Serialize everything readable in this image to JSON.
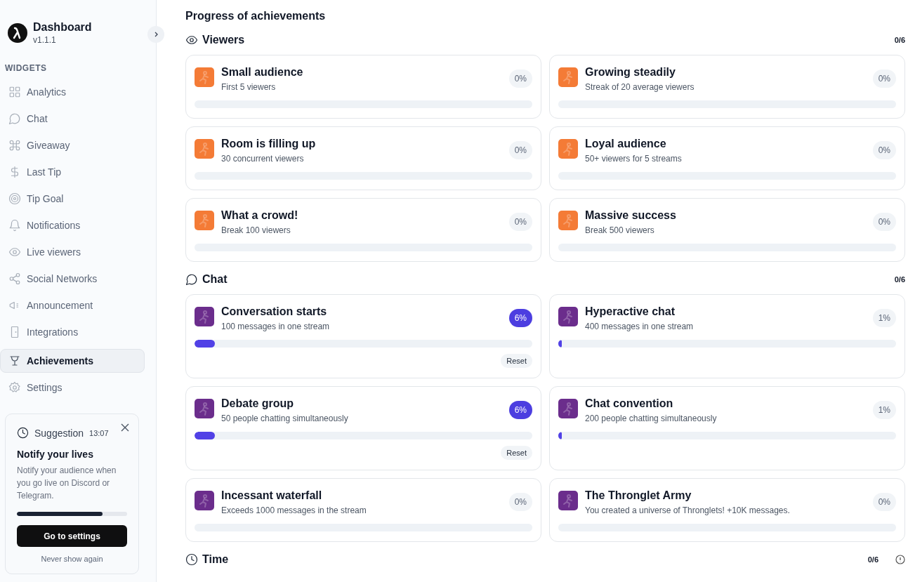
{
  "sidebar": {
    "app_name": "Dashboard",
    "version": "v1.1.1",
    "section_label": "WIDGETS",
    "items": [
      {
        "label": "Analytics",
        "selected": false
      },
      {
        "label": "Chat",
        "selected": false
      },
      {
        "label": "Giveaway",
        "selected": false
      },
      {
        "label": "Last Tip",
        "selected": false
      },
      {
        "label": "Tip Goal",
        "selected": false
      },
      {
        "label": "Notifications",
        "selected": false
      },
      {
        "label": "Live viewers",
        "selected": false
      },
      {
        "label": "Social Networks",
        "selected": false
      },
      {
        "label": "Announcement",
        "selected": false
      },
      {
        "label": "Integrations",
        "selected": false
      },
      {
        "label": "Achievements",
        "selected": true
      },
      {
        "label": "Settings",
        "selected": false
      }
    ],
    "suggestion": {
      "label": "Suggestion",
      "time": "13:07",
      "title": "Notify your lives",
      "text": "Notify your audience when you go live on Discord or Telegram.",
      "level": 0.78,
      "button": "Go to settings",
      "dismiss": "Never show again"
    }
  },
  "main": {
    "title": "Progress of achievements",
    "sections": [
      {
        "title": "Viewers",
        "count": "0/6",
        "cards": [
          {
            "title": "Small audience",
            "subtitle": "First 5 viewers",
            "percent": "0%",
            "level": 0,
            "color": "#f47b36",
            "highlighted": false
          },
          {
            "title": "Growing steadily",
            "subtitle": "Streak of 20 average viewers",
            "percent": "0%",
            "level": 0,
            "color": "#f47b36",
            "highlighted": false
          },
          {
            "title": "Room is filling up",
            "subtitle": "30 concurrent viewers",
            "percent": "0%",
            "level": 0,
            "color": "#f47b36",
            "highlighted": false
          },
          {
            "title": "Loyal audience",
            "subtitle": "50+ viewers for 5 streams",
            "percent": "0%",
            "level": 0,
            "color": "#f47b36",
            "highlighted": false
          },
          {
            "title": "What a crowd!",
            "subtitle": "Break 100 viewers",
            "percent": "0%",
            "level": 0,
            "color": "#f47b36",
            "highlighted": false
          },
          {
            "title": "Massive success",
            "subtitle": "Break 500 viewers",
            "percent": "0%",
            "level": 0,
            "color": "#f47b36",
            "highlighted": false
          }
        ]
      },
      {
        "title": "Chat",
        "count": "0/6",
        "cards": [
          {
            "title": "Conversation starts",
            "subtitle": "100 messages in one stream",
            "percent": "6%",
            "level": 0.06,
            "color": "#6b2d8c",
            "highlighted": true,
            "action": "Reset"
          },
          {
            "title": "Hyperactive chat",
            "subtitle": "400 messages in one stream",
            "percent": "1%",
            "level": 0.01,
            "color": "#6b2d8c",
            "highlighted": false
          },
          {
            "title": "Debate group",
            "subtitle": "50 people chatting simultaneously",
            "percent": "6%",
            "level": 0.06,
            "color": "#6b2d8c",
            "highlighted": true,
            "action": "Reset"
          },
          {
            "title": "Chat convention",
            "subtitle": "200 people chatting simultaneously",
            "percent": "1%",
            "level": 0.01,
            "color": "#6b2d8c",
            "highlighted": false
          },
          {
            "title": "Incessant waterfall",
            "subtitle": "Exceeds 1000 messages in the stream",
            "percent": "0%",
            "level": 0,
            "color": "#6b2d8c",
            "highlighted": false
          },
          {
            "title": "The Thronglet Army",
            "subtitle": "You created a universe of Thronglets! +10K messages.",
            "percent": "0%",
            "level": 0,
            "color": "#6b2d8c",
            "highlighted": false
          }
        ]
      },
      {
        "title": "Time",
        "count": "0/6",
        "help": true
      }
    ]
  }
}
